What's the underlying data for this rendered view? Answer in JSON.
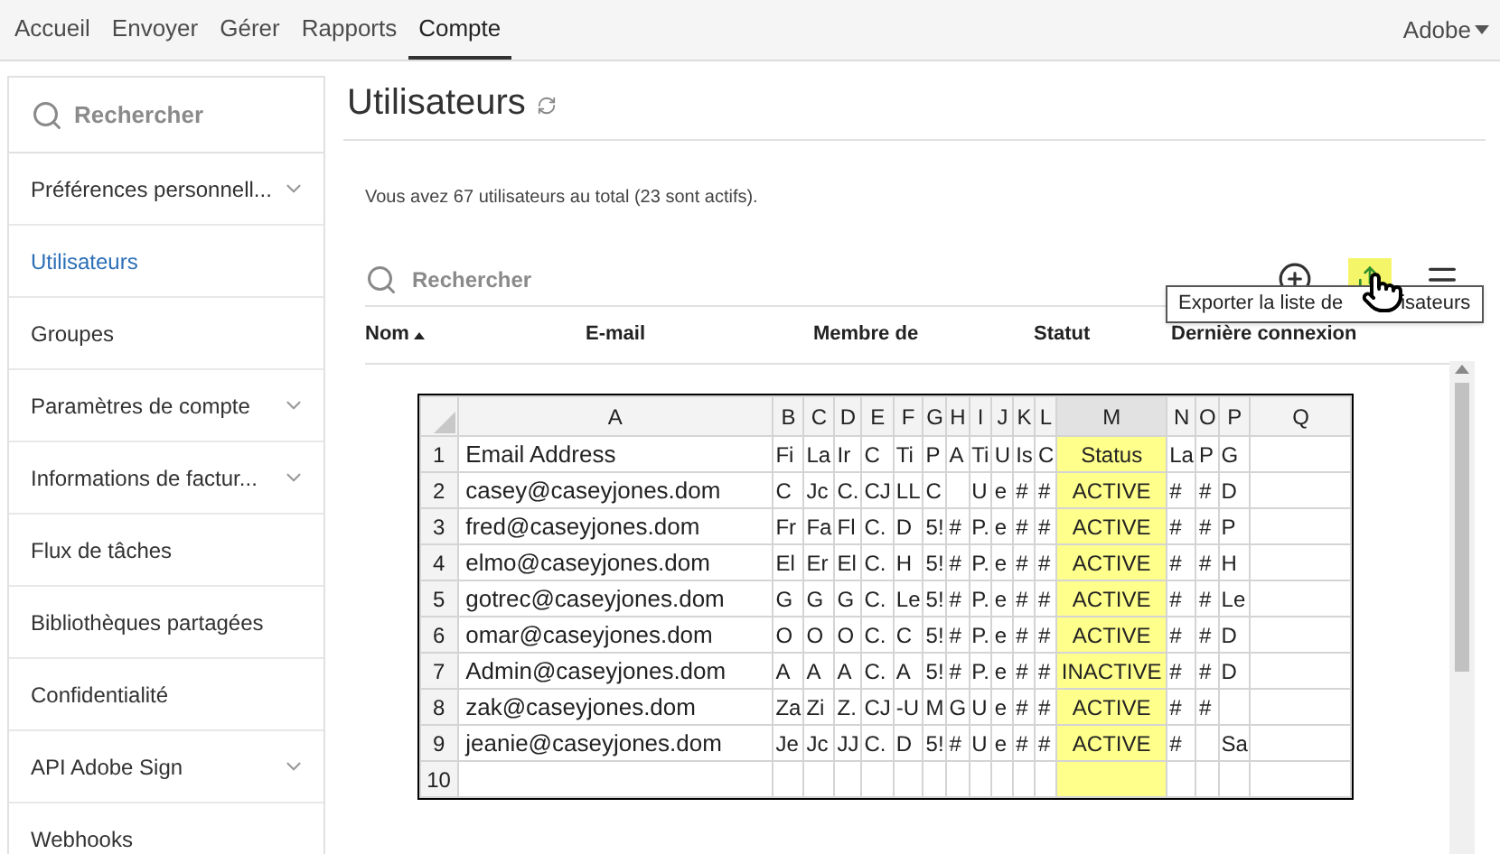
{
  "nav": {
    "tabs": [
      {
        "label": "Accueil",
        "selected": false
      },
      {
        "label": "Envoyer",
        "selected": false
      },
      {
        "label": "Gérer",
        "selected": false
      },
      {
        "label": "Rapports",
        "selected": false
      },
      {
        "label": "Compte",
        "selected": true
      }
    ],
    "account": "Adobe"
  },
  "sidebar": {
    "search": {
      "placeholder": "Rechercher"
    },
    "items": [
      {
        "label": "Préférences personnell...",
        "expandable": true,
        "selected": false
      },
      {
        "label": "Utilisateurs",
        "expandable": false,
        "selected": true
      },
      {
        "label": "Groupes",
        "expandable": false,
        "selected": false
      },
      {
        "label": "Paramètres de compte",
        "expandable": true,
        "selected": false
      },
      {
        "label": "Informations de factur...",
        "expandable": true,
        "selected": false
      },
      {
        "label": "Flux de tâches",
        "expandable": false,
        "selected": false
      },
      {
        "label": "Bibliothèques partagées",
        "expandable": false,
        "selected": false
      },
      {
        "label": "Confidentialité",
        "expandable": false,
        "selected": false
      },
      {
        "label": "API Adobe Sign",
        "expandable": true,
        "selected": false
      },
      {
        "label": "Webhooks",
        "expandable": false,
        "selected": false
      }
    ]
  },
  "main": {
    "title": "Utilisateurs",
    "summary": "Vous avez 67 utilisateurs au total (23 sont actifs).",
    "search": {
      "placeholder": "Rechercher"
    },
    "tooltip": [
      "Exporter la liste de",
      "isateurs"
    ],
    "columns": [
      {
        "label": "Nom",
        "sorted": true
      },
      {
        "label": "E-mail",
        "sorted": false
      },
      {
        "label": "Membre de",
        "sorted": false
      },
      {
        "label": "Statut",
        "sorted": false
      },
      {
        "label": "Dernière connexion",
        "sorted": false
      }
    ]
  },
  "spreadsheet": {
    "columns": [
      {
        "label": "A",
        "highlighted": false
      },
      {
        "label": "B",
        "highlighted": false
      },
      {
        "label": "C",
        "highlighted": false
      },
      {
        "label": "D",
        "highlighted": false
      },
      {
        "label": "E",
        "highlighted": false
      },
      {
        "label": "F",
        "highlighted": false
      },
      {
        "label": "G",
        "highlighted": false
      },
      {
        "label": "H",
        "highlighted": false
      },
      {
        "label": "I",
        "highlighted": false
      },
      {
        "label": "J",
        "highlighted": false
      },
      {
        "label": "K",
        "highlighted": false
      },
      {
        "label": "L",
        "highlighted": false
      },
      {
        "label": "M",
        "highlighted": true
      },
      {
        "label": "N",
        "highlighted": false
      },
      {
        "label": "O",
        "highlighted": false
      },
      {
        "label": "P",
        "highlighted": false
      },
      {
        "label": "Q",
        "highlighted": false
      }
    ],
    "rows": [
      {
        "number": "1",
        "cells": [
          {
            "text": "Email Address"
          },
          {
            "text": "Fi"
          },
          {
            "text": "La"
          },
          {
            "text": "Ir"
          },
          {
            "text": "C"
          },
          {
            "text": "Ti"
          },
          {
            "text": "P"
          },
          {
            "text": "A"
          },
          {
            "text": "Ti"
          },
          {
            "text": "U"
          },
          {
            "text": "Is"
          },
          {
            "text": "C"
          },
          {
            "text": "Status"
          },
          {
            "text": "La"
          },
          {
            "text": "P"
          },
          {
            "text": "G"
          },
          {
            "text": ""
          }
        ]
      },
      {
        "number": "2",
        "cells": [
          {
            "text": "casey@caseyjones.dom"
          },
          {
            "text": "C"
          },
          {
            "text": "Jc"
          },
          {
            "text": "C."
          },
          {
            "text": "CJ"
          },
          {
            "text": "LL"
          },
          {
            "text": "C"
          },
          {
            "text": ""
          },
          {
            "text": "U"
          },
          {
            "text": "e"
          },
          {
            "text": "#"
          },
          {
            "text": "#"
          },
          {
            "text": "ACTIVE"
          },
          {
            "text": "#"
          },
          {
            "text": "#"
          },
          {
            "text": "D"
          },
          {
            "text": ""
          }
        ]
      },
      {
        "number": "3",
        "cells": [
          {
            "text": "fred@caseyjones.dom"
          },
          {
            "text": "Fr"
          },
          {
            "text": "Fa"
          },
          {
            "text": "Fl"
          },
          {
            "text": "C."
          },
          {
            "text": "D"
          },
          {
            "text": "5!"
          },
          {
            "text": "#"
          },
          {
            "text": "P."
          },
          {
            "text": "e"
          },
          {
            "text": "#"
          },
          {
            "text": "#"
          },
          {
            "text": "ACTIVE"
          },
          {
            "text": "#"
          },
          {
            "text": "#"
          },
          {
            "text": "P"
          },
          {
            "text": ""
          }
        ]
      },
      {
        "number": "4",
        "cells": [
          {
            "text": "elmo@caseyjones.dom"
          },
          {
            "text": "El"
          },
          {
            "text": "Er"
          },
          {
            "text": "El"
          },
          {
            "text": "C."
          },
          {
            "text": "H"
          },
          {
            "text": "5!"
          },
          {
            "text": "#"
          },
          {
            "text": "P."
          },
          {
            "text": "e"
          },
          {
            "text": "#"
          },
          {
            "text": "#"
          },
          {
            "text": "ACTIVE"
          },
          {
            "text": "#"
          },
          {
            "text": "#"
          },
          {
            "text": "H"
          },
          {
            "text": ""
          }
        ]
      },
      {
        "number": "5",
        "cells": [
          {
            "text": "gotrec@caseyjones.dom"
          },
          {
            "text": "G"
          },
          {
            "text": "G"
          },
          {
            "text": "G"
          },
          {
            "text": "C."
          },
          {
            "text": "Le"
          },
          {
            "text": "5!"
          },
          {
            "text": "#"
          },
          {
            "text": "P."
          },
          {
            "text": "e"
          },
          {
            "text": "#"
          },
          {
            "text": "#"
          },
          {
            "text": "ACTIVE"
          },
          {
            "text": "#"
          },
          {
            "text": "#"
          },
          {
            "text": "Le"
          },
          {
            "text": ""
          }
        ]
      },
      {
        "number": "6",
        "cells": [
          {
            "text": "omar@caseyjones.dom"
          },
          {
            "text": "O"
          },
          {
            "text": "O"
          },
          {
            "text": "O"
          },
          {
            "text": "C."
          },
          {
            "text": "C"
          },
          {
            "text": "5!"
          },
          {
            "text": "#"
          },
          {
            "text": "P."
          },
          {
            "text": "e"
          },
          {
            "text": "#"
          },
          {
            "text": "#"
          },
          {
            "text": "ACTIVE"
          },
          {
            "text": "#"
          },
          {
            "text": "#"
          },
          {
            "text": "D"
          },
          {
            "text": ""
          }
        ]
      },
      {
        "number": "7",
        "cells": [
          {
            "text": "Admin@caseyjones.dom"
          },
          {
            "text": "A"
          },
          {
            "text": "A"
          },
          {
            "text": "A"
          },
          {
            "text": "C."
          },
          {
            "text": "A"
          },
          {
            "text": "5!"
          },
          {
            "text": "#"
          },
          {
            "text": "P."
          },
          {
            "text": "e"
          },
          {
            "text": "#"
          },
          {
            "text": "#"
          },
          {
            "text": "INACTIVE"
          },
          {
            "text": "#"
          },
          {
            "text": "#"
          },
          {
            "text": "D"
          },
          {
            "text": ""
          }
        ]
      },
      {
        "number": "8",
        "cells": [
          {
            "text": "zak@caseyjones.dom"
          },
          {
            "text": "Za"
          },
          {
            "text": "Zi"
          },
          {
            "text": "Z."
          },
          {
            "text": "CJ"
          },
          {
            "text": "-U"
          },
          {
            "text": "M"
          },
          {
            "text": "G"
          },
          {
            "text": "U"
          },
          {
            "text": "e"
          },
          {
            "text": "#"
          },
          {
            "text": "#"
          },
          {
            "text": "ACTIVE"
          },
          {
            "text": "#"
          },
          {
            "text": "#"
          },
          {
            "text": ""
          },
          {
            "text": ""
          }
        ]
      },
      {
        "number": "9",
        "cells": [
          {
            "text": "jeanie@caseyjones.dom"
          },
          {
            "text": "Je"
          },
          {
            "text": "Jc"
          },
          {
            "text": "JJ"
          },
          {
            "text": "C."
          },
          {
            "text": "D"
          },
          {
            "text": "5!"
          },
          {
            "text": "#"
          },
          {
            "text": "U"
          },
          {
            "text": "e"
          },
          {
            "text": "#"
          },
          {
            "text": "#"
          },
          {
            "text": "ACTIVE"
          },
          {
            "text": "#"
          },
          {
            "text": ""
          },
          {
            "text": "Sa"
          },
          {
            "text": ""
          }
        ]
      },
      {
        "number": "10",
        "cells": [
          {
            "text": ""
          },
          {
            "text": ""
          },
          {
            "text": ""
          },
          {
            "text": ""
          },
          {
            "text": ""
          },
          {
            "text": ""
          },
          {
            "text": ""
          },
          {
            "text": ""
          },
          {
            "text": ""
          },
          {
            "text": ""
          },
          {
            "text": ""
          },
          {
            "text": ""
          },
          {
            "text": ""
          },
          {
            "text": ""
          },
          {
            "text": ""
          },
          {
            "text": ""
          },
          {
            "text": ""
          }
        ]
      }
    ]
  }
}
